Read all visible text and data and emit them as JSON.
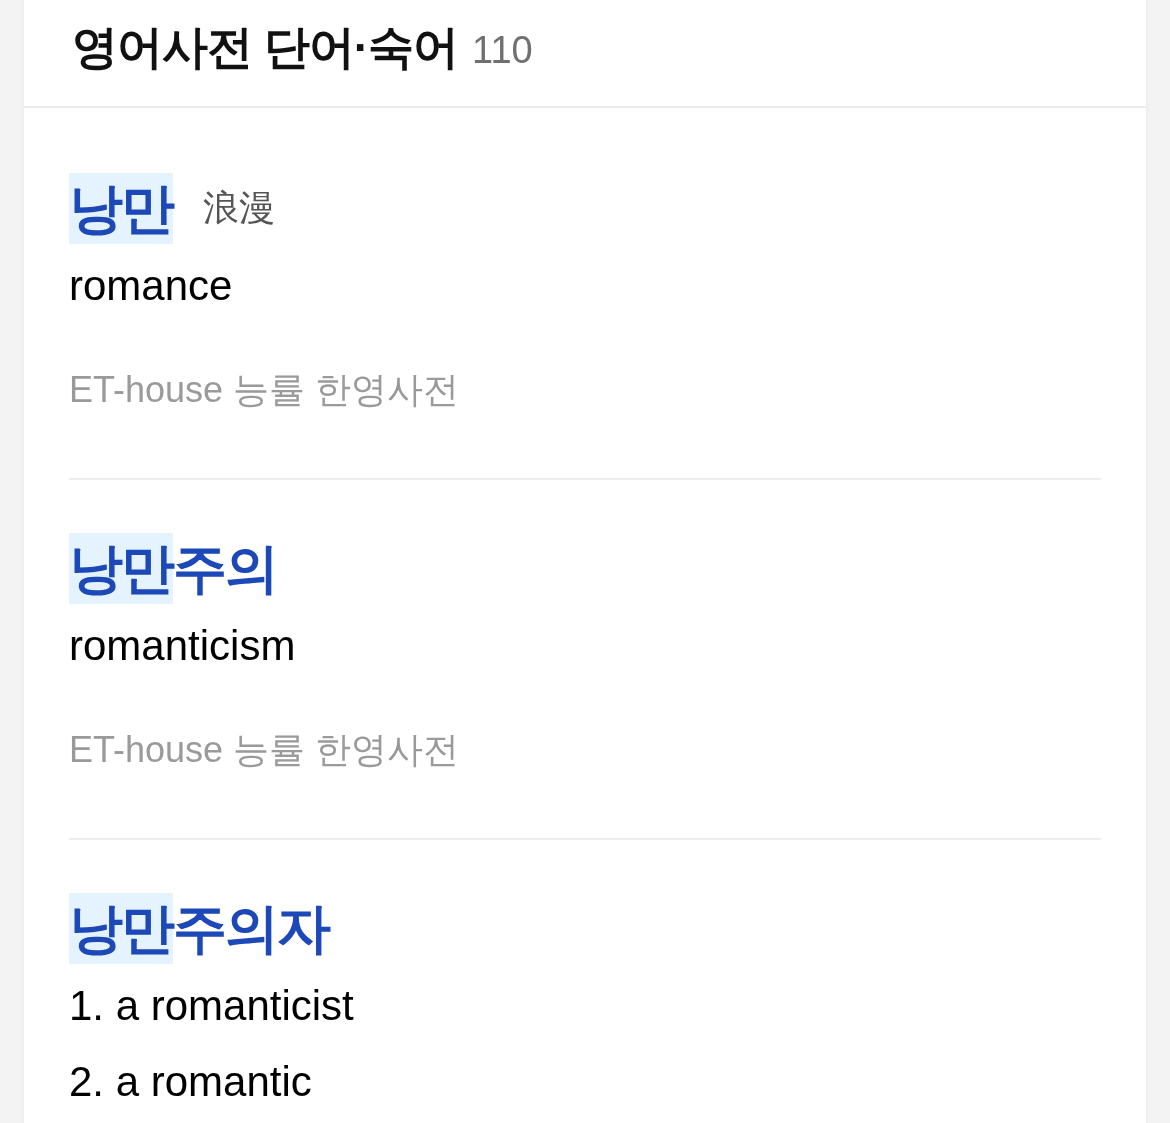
{
  "header": {
    "title": "영어사전 단어·숙어",
    "count": "110"
  },
  "entries": [
    {
      "kind": "single",
      "headword_parts": [
        {
          "text": "낭만",
          "highlighted": true
        }
      ],
      "hanja": "浪漫",
      "meaning": "romance",
      "source": "ET-house 능률 한영사전"
    },
    {
      "kind": "single",
      "headword_parts": [
        {
          "text": "낭만",
          "highlighted": true
        },
        {
          "text": "주의",
          "highlighted": false
        }
      ],
      "meaning": "romanticism",
      "source": "ET-house 능률 한영사전"
    },
    {
      "kind": "numbered",
      "headword_parts": [
        {
          "text": "낭만",
          "highlighted": true
        },
        {
          "text": "주의자",
          "highlighted": false
        }
      ],
      "senses": [
        "1. a romanticist",
        "2. a romantic"
      ]
    }
  ]
}
